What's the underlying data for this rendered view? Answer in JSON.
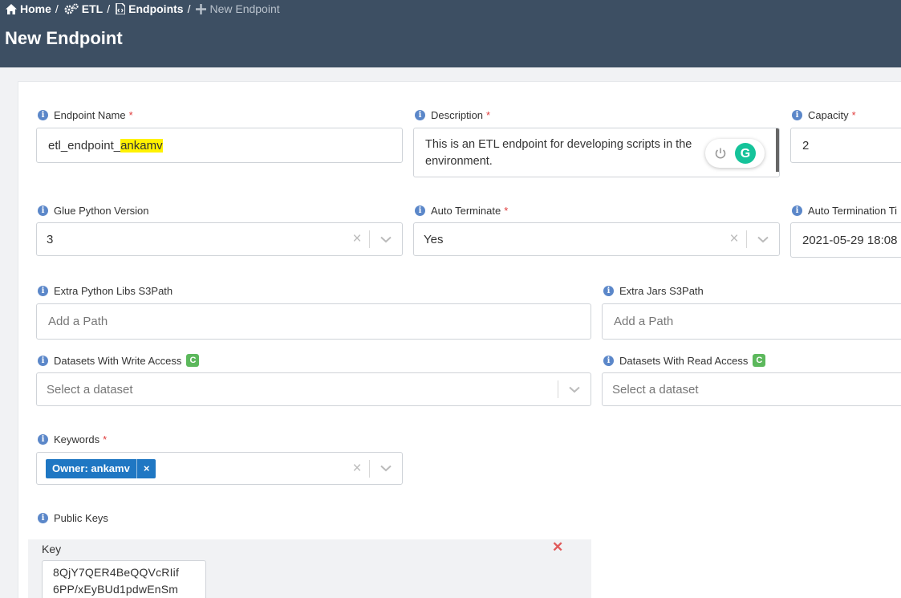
{
  "breadcrumb": {
    "home": "Home",
    "etl": "ETL",
    "endpoints": "Endpoints",
    "current": "New Endpoint",
    "separator": "/"
  },
  "page": {
    "title": "New Endpoint"
  },
  "form": {
    "endpoint_name": {
      "label": "Endpoint Name",
      "value_prefix": "etl_endpoint_",
      "value_highlight": "ankamv"
    },
    "description": {
      "label": "Description",
      "line1": "This is an ETL endpoint for developing scripts in the",
      "line2": "environment."
    },
    "capacity": {
      "label": "Capacity",
      "value": "2"
    },
    "glue_python_version": {
      "label": "Glue Python Version",
      "value": "3"
    },
    "auto_terminate": {
      "label": "Auto Terminate",
      "value": "Yes"
    },
    "auto_termination_time": {
      "label": "Auto Termination Ti",
      "value": "2021-05-29 18:08"
    },
    "extra_python_libs": {
      "label": "Extra Python Libs S3Path",
      "placeholder": "Add a Path"
    },
    "extra_jars": {
      "label": "Extra Jars S3Path",
      "placeholder": "Add a Path"
    },
    "datasets_write": {
      "label": "Datasets With Write Access",
      "placeholder": "Select a dataset"
    },
    "datasets_read": {
      "label": "Datasets With Read Access",
      "placeholder": "Select a dataset"
    },
    "keywords": {
      "label": "Keywords",
      "tag": "Owner: ankamv",
      "tag_remove": "×"
    },
    "public_keys": {
      "label": "Public Keys",
      "key_label": "Key",
      "key_line1": "8QjY7QER4BeQQVcRIif",
      "key_line2": "6PP/xEyBUd1pdwEnSm",
      "remove": "✕"
    }
  },
  "glyphs": {
    "required": "*",
    "info": "i",
    "clear": "×",
    "refresh": "C",
    "grammarly": "G"
  },
  "colors": {
    "header_bg": "#3d4f63",
    "tag_bg": "#1f77c3",
    "required": "#e03c3c",
    "refresh_green": "#5cb85c",
    "info_blue": "#5b87c9"
  }
}
